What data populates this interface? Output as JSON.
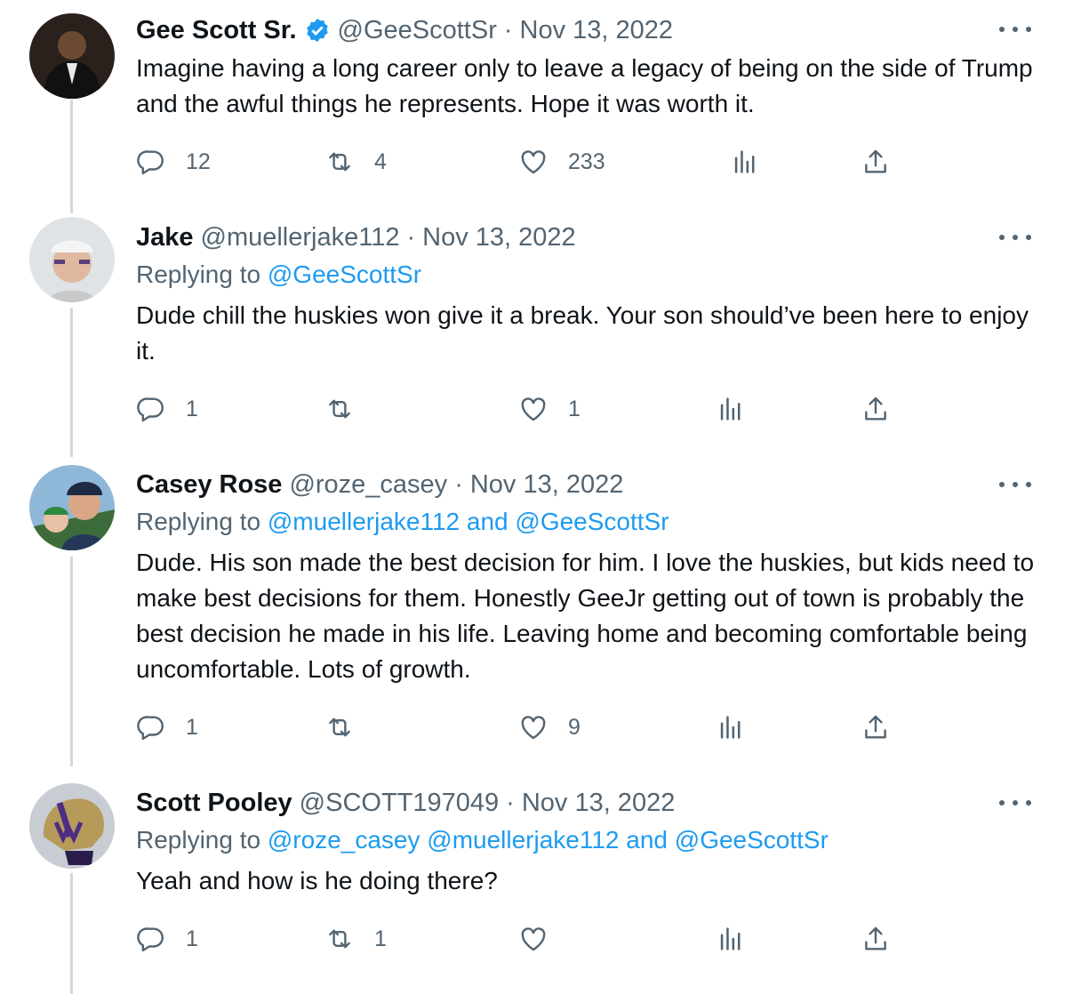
{
  "tweets": [
    {
      "name": "Gee Scott Sr.",
      "verified": true,
      "handle": "@GeeScottSr",
      "dot": "·",
      "date": "Nov 13, 2022",
      "replying_prefix": "",
      "replying_to": [],
      "replying_joiners": [],
      "text": "Imagine having a long career only to leave a legacy of being on the side of Trump and the awful things he represents. Hope it was worth it.",
      "replies": "12",
      "retweets": "4",
      "likes": "233",
      "avatar_icon": "user-avatar"
    },
    {
      "name": "Jake",
      "verified": false,
      "handle": "@muellerjake112",
      "dot": "·",
      "date": "Nov 13, 2022",
      "replying_prefix": "Replying to",
      "replying_to": [
        "@GeeScottSr"
      ],
      "replying_joiners": [],
      "text": "Dude chill the huskies won give it a break. Your son should’ve been here to enjoy it.",
      "replies": "1",
      "retweets": "",
      "likes": "1",
      "avatar_icon": "user-avatar"
    },
    {
      "name": "Casey Rose",
      "verified": false,
      "handle": "@roze_casey",
      "dot": "·",
      "date": "Nov 13, 2022",
      "replying_prefix": "Replying to",
      "replying_to": [
        "@muellerjake112",
        "@GeeScottSr"
      ],
      "replying_joiners": [
        " and "
      ],
      "text": "Dude. His son made the best decision for him. I love the huskies, but kids need to make best decisions for them. Honestly GeeJr getting out of town is probably the best decision he made in his life. Leaving home and becoming comfortable being uncomfortable. Lots of growth.",
      "replies": "1",
      "retweets": "",
      "likes": "9",
      "avatar_icon": "user-avatar"
    },
    {
      "name": "Scott Pooley",
      "verified": false,
      "handle": "@SCOTT197049",
      "dot": "·",
      "date": "Nov 13, 2022",
      "replying_prefix": "Replying to",
      "replying_to": [
        "@roze_casey",
        "@muellerjake112",
        "@GeeScottSr"
      ],
      "replying_joiners": [
        " ",
        " and "
      ],
      "text": "Yeah and how is he doing there?",
      "replies": "1",
      "retweets": "1",
      "likes": "",
      "avatar_icon": "helmet-avatar"
    }
  ],
  "colors": {
    "text": "#0f1419",
    "secondary": "#536471",
    "accent": "#1d9bf0",
    "thread_line": "#cfd9de"
  },
  "icons": [
    "reply-icon",
    "retweet-icon",
    "like-icon",
    "analytics-icon",
    "share-icon",
    "more-icon",
    "verified-badge-icon"
  ]
}
